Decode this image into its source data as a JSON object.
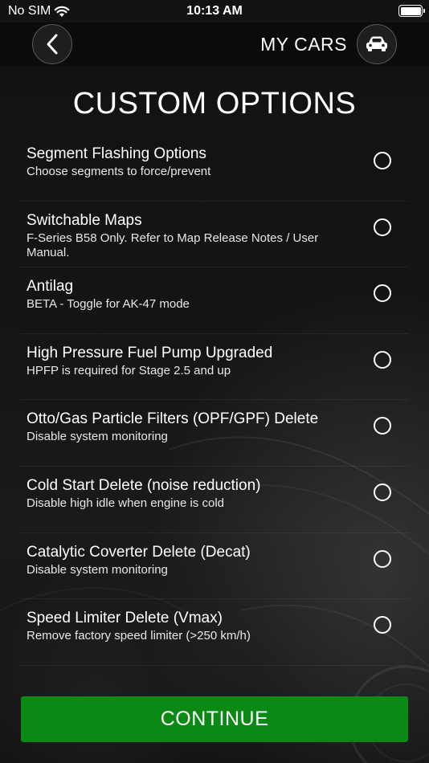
{
  "status_bar": {
    "carrier": "No SIM",
    "time": "10:13 AM"
  },
  "nav": {
    "back_icon": "chevron-left-icon",
    "my_cars_label": "MY CARS",
    "car_icon": "car-icon"
  },
  "page": {
    "title": "CUSTOM OPTIONS"
  },
  "options": [
    {
      "title": "Segment Flashing Options",
      "subtitle": "Choose segments to force/prevent",
      "selected": false
    },
    {
      "title": "Switchable Maps",
      "subtitle": "F-Series B58 Only. Refer to Map Release Notes / User Manual.",
      "selected": false
    },
    {
      "title": "Antilag",
      "subtitle": "BETA - Toggle for AK-47 mode",
      "selected": false
    },
    {
      "title": "High Pressure Fuel Pump Upgraded",
      "subtitle": "HPFP is required for Stage 2.5 and up",
      "selected": false
    },
    {
      "title": "Otto/Gas Particle Filters (OPF/GPF) Delete",
      "subtitle": "Disable system monitoring",
      "selected": false
    },
    {
      "title": "Cold Start Delete (noise reduction)",
      "subtitle": "Disable high idle when engine is cold",
      "selected": false
    },
    {
      "title": "Catalytic Coverter Delete (Decat)",
      "subtitle": "Disable system monitoring",
      "selected": false
    },
    {
      "title": "Speed Limiter Delete (Vmax)",
      "subtitle": "Remove factory speed limiter (>250 km/h)",
      "selected": false
    }
  ],
  "footer": {
    "continue_label": "CONTINUE"
  },
  "colors": {
    "accent_green": "#0a8a14",
    "background": "#141414"
  }
}
